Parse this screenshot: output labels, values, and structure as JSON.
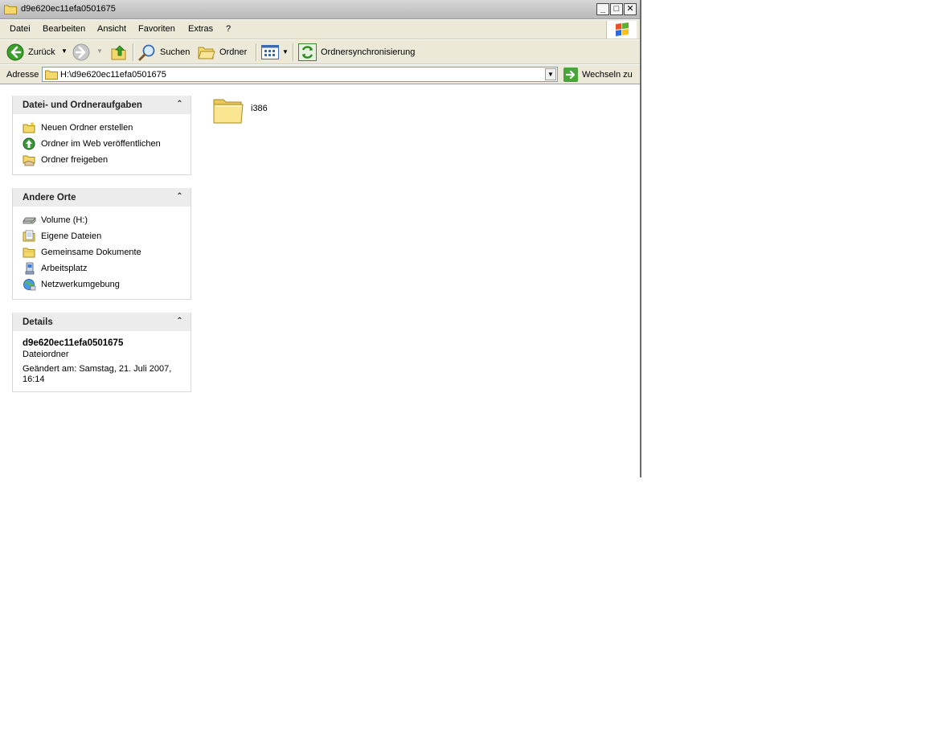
{
  "window": {
    "title": "d9e620ec11efa0501675",
    "minimize_glyph": "_",
    "maximize_glyph": "□",
    "close_glyph": "✕"
  },
  "menu": {
    "items": [
      "Datei",
      "Bearbeiten",
      "Ansicht",
      "Favoriten",
      "Extras",
      "?"
    ]
  },
  "toolbar": {
    "back_label": "Zurück",
    "search_label": "Suchen",
    "folders_label": "Ordner",
    "sync_label": "Ordnersynchronisierung"
  },
  "address": {
    "label": "Adresse",
    "value": "H:\\d9e620ec11efa0501675",
    "go_label": "Wechseln zu"
  },
  "panels": {
    "tasks": {
      "title": "Datei- und Ordneraufgaben",
      "items": [
        {
          "label": "Neuen Ordner erstellen",
          "icon": "new-folder-icon"
        },
        {
          "label": "Ordner im Web veröffentlichen",
          "icon": "publish-web-icon"
        },
        {
          "label": "Ordner freigeben",
          "icon": "share-folder-icon"
        }
      ]
    },
    "places": {
      "title": "Andere Orte",
      "items": [
        {
          "label": "Volume (H:)",
          "icon": "drive-icon"
        },
        {
          "label": "Eigene Dateien",
          "icon": "my-documents-icon"
        },
        {
          "label": "Gemeinsame Dokumente",
          "icon": "shared-documents-icon"
        },
        {
          "label": "Arbeitsplatz",
          "icon": "my-computer-icon"
        },
        {
          "label": "Netzwerkumgebung",
          "icon": "network-icon"
        }
      ]
    },
    "details": {
      "title": "Details",
      "name": "d9e620ec11efa0501675",
      "type": "Dateiordner",
      "modified_line1": "Geändert am: Samstag, 21. Juli 2007,",
      "modified_line2": "16:14"
    }
  },
  "files": [
    {
      "name": "i386",
      "icon": "folder-icon"
    }
  ],
  "colors": {
    "chrome": "#ece9d8",
    "panel_header": "#ececec",
    "folder_yellow": "#f5d86a",
    "go_green": "#4aa43a"
  }
}
